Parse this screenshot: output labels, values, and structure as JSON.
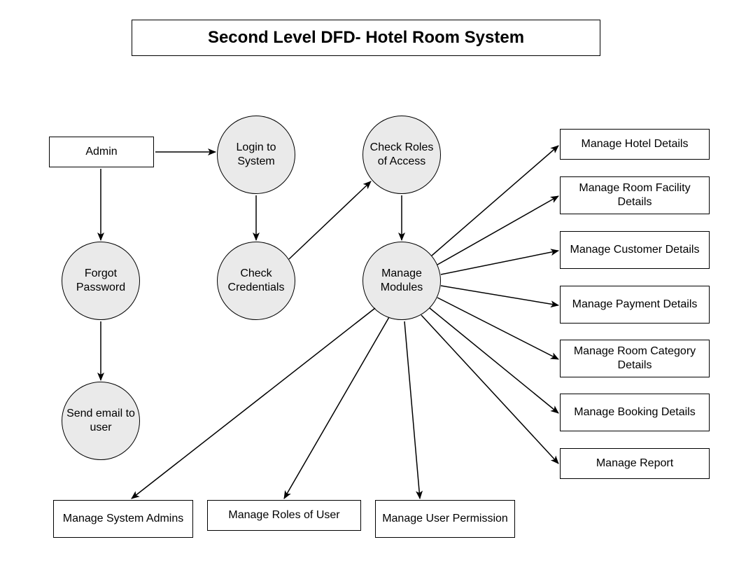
{
  "title": "Second Level DFD- Hotel Room System",
  "entities": {
    "admin": "Admin"
  },
  "processes": {
    "login": "Login to System",
    "forgot": "Forgot Password",
    "sendemail": "Send email to user",
    "checkcred": "Check Credentials",
    "checkroles": "Check Roles of Access",
    "managemodules": "Manage Modules"
  },
  "stores": {
    "hotel": "Manage Hotel Details",
    "roomfacility": "Manage Room Facility Details",
    "customer": "Manage Customer Details",
    "payment": "Manage Payment Details",
    "roomcategory": "Manage Room Category Details",
    "booking": "Manage Booking Details",
    "report": "Manage Report",
    "sysadmins": "Manage System Admins",
    "rolesuser": "Manage Roles of User",
    "userperm": "Manage User Permission"
  }
}
